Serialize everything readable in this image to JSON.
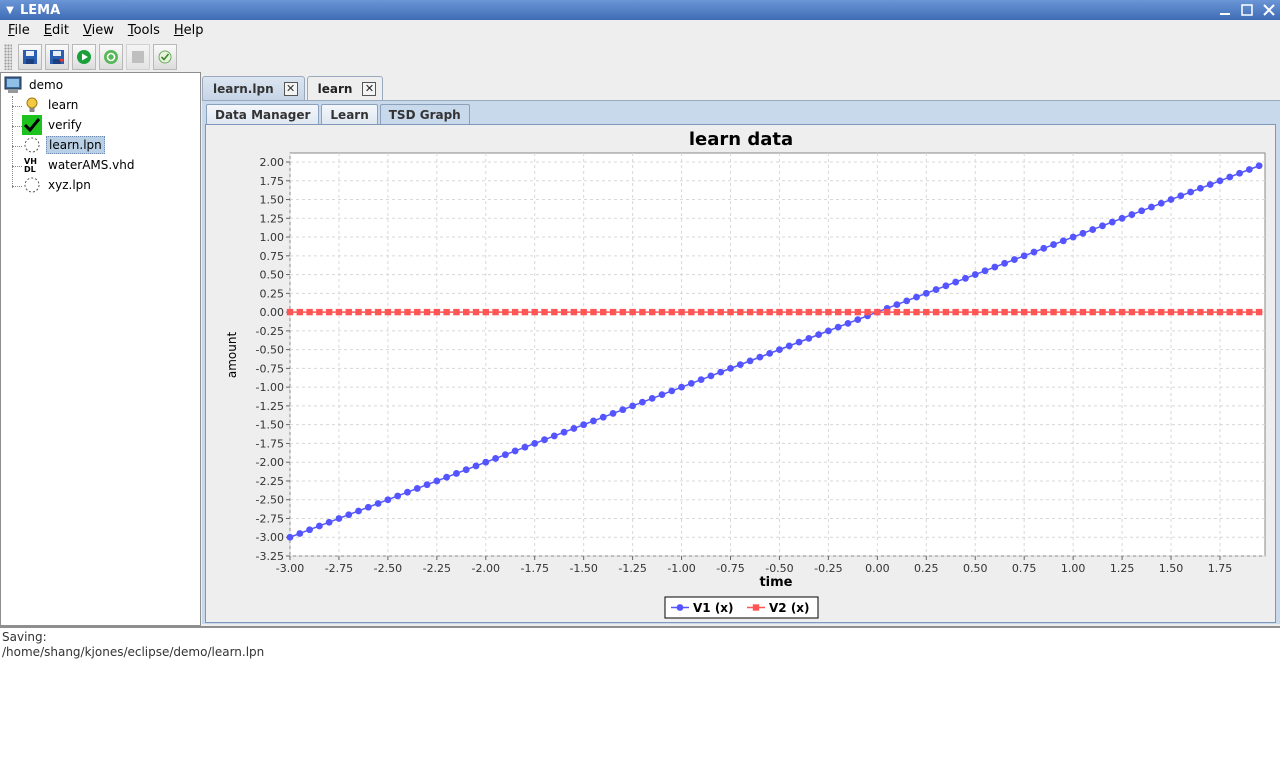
{
  "window": {
    "title": "LEMA"
  },
  "menu": [
    "File",
    "Edit",
    "View",
    "Tools",
    "Help"
  ],
  "toolbar": [
    {
      "name": "save-icon",
      "disabled": false
    },
    {
      "name": "save-as-icon",
      "disabled": false
    },
    {
      "name": "run-icon",
      "disabled": false
    },
    {
      "name": "refresh-icon",
      "disabled": false
    },
    {
      "name": "stop-icon",
      "disabled": true
    },
    {
      "name": "check-icon",
      "disabled": false
    }
  ],
  "tree": {
    "root": "demo",
    "items": [
      {
        "label": "learn",
        "icon": "lightbulb-icon"
      },
      {
        "label": "verify",
        "icon": "checkmark-icon"
      },
      {
        "label": "learn.lpn",
        "icon": "lpn-file-icon",
        "selected": true
      },
      {
        "label": "waterAMS.vhd",
        "icon": "vhdl-file-icon"
      },
      {
        "label": "xyz.lpn",
        "icon": "lpn-file-icon"
      }
    ]
  },
  "tabs": [
    {
      "label": "learn.lpn",
      "active": false
    },
    {
      "label": "learn",
      "active": true
    }
  ],
  "subtabs": [
    {
      "label": "Data Manager",
      "active": false
    },
    {
      "label": "Learn",
      "active": false
    },
    {
      "label": "TSD Graph",
      "active": true
    }
  ],
  "chart_data": {
    "type": "line",
    "title": "learn data",
    "xlabel": "time",
    "ylabel": "amount",
    "xlim": [
      -3.0,
      1.98
    ],
    "ylim": [
      -3.25,
      2.12
    ],
    "xticks": [
      "-3.00",
      "-2.75",
      "-2.50",
      "-2.25",
      "-2.00",
      "-1.75",
      "-1.50",
      "-1.25",
      "-1.00",
      "-0.75",
      "-0.50",
      "-0.25",
      "0.00",
      "0.25",
      "0.50",
      "0.75",
      "1.00",
      "1.25",
      "1.50",
      "1.75"
    ],
    "yticks": [
      "2.00",
      "1.75",
      "1.50",
      "1.25",
      "1.00",
      "0.75",
      "0.50",
      "0.25",
      "0.00",
      "-0.25",
      "-0.50",
      "-0.75",
      "-1.00",
      "-1.25",
      "-1.50",
      "-1.75",
      "-2.00",
      "-2.25",
      "-2.50",
      "-2.75",
      "-3.00",
      "-3.25"
    ],
    "x_start": -3.0,
    "x_step": 0.05,
    "x_count": 100,
    "grid": true,
    "legend_position": "bottom",
    "series": [
      {
        "name": "V1 (x)",
        "color": "#5555ff",
        "marker": "circle",
        "slope": 1.0,
        "intercept": 0.0
      },
      {
        "name": "V2 (x)",
        "color": "#ff5555",
        "marker": "square",
        "slope": 0.0,
        "intercept": 0.0
      }
    ]
  },
  "console": {
    "line1": "Saving:",
    "line2": "/home/shang/kjones/eclipse/demo/learn.lpn"
  }
}
